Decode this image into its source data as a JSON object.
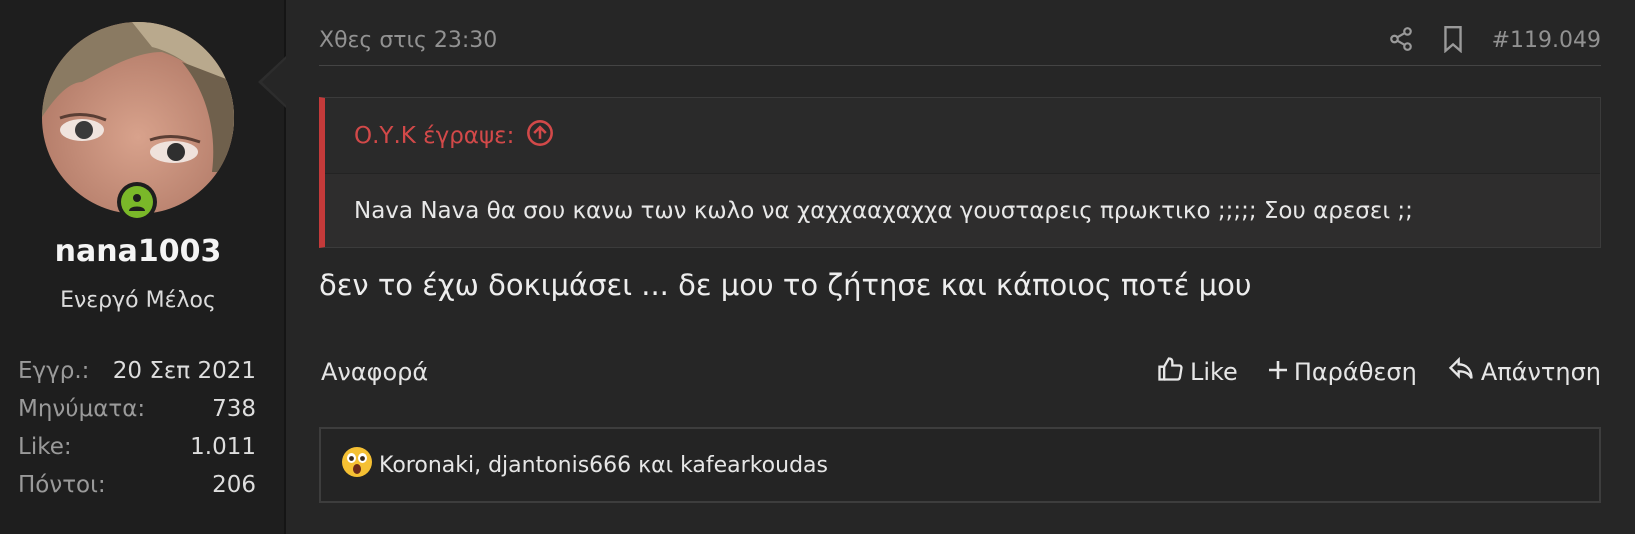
{
  "user": {
    "username": "nana1003",
    "title": "Ενεργό Μέλος",
    "stats": [
      {
        "label": "Εγγρ.:",
        "value": "20 Σεπ 2021"
      },
      {
        "label": "Μηνύματα:",
        "value": "738"
      },
      {
        "label": "Like:",
        "value": "1.011"
      },
      {
        "label": "Πόντοι:",
        "value": "206"
      }
    ]
  },
  "post": {
    "date": "Χθες στις 23:30",
    "number": "#119.049",
    "quote": {
      "author": "Ο.Υ.Κ έγραψε:",
      "text": "Nava Nava θα σου κανω των κωλο να χαχχααχαχχα γουσταρεις πρωκτικο ;;;;; Σου αρεσει ;;"
    },
    "message": "δεν το έχω δοκιμάσει ... δε μου το ζήτησε και κάποιος ποτέ μου",
    "actions": {
      "report": "Αναφορά",
      "like": "Like",
      "quote": "Παράθεση",
      "reply": "Απάντηση"
    },
    "reactions": "Koronaki, djantonis666 και kafearkoudas"
  },
  "colors": {
    "accent_red": "#c43a3a",
    "online_green": "#7ab829"
  },
  "icons": [
    "share-icon",
    "bookmark-icon",
    "arrow-up-circle-icon",
    "thumbs-up-icon",
    "plus-icon",
    "reply-icon",
    "wow-emoji-icon",
    "user-icon"
  ]
}
